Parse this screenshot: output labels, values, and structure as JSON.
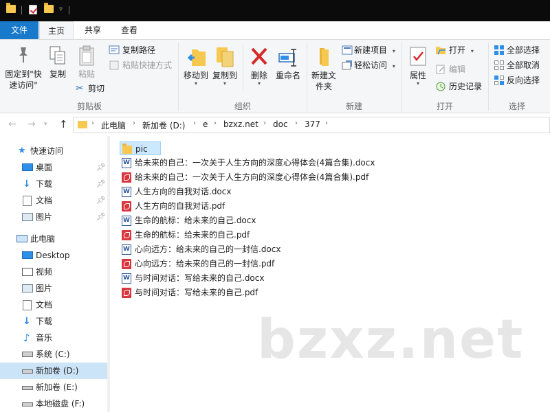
{
  "tabs": {
    "file": "文件",
    "home": "主页",
    "share": "共享",
    "view": "查看"
  },
  "ribbon": {
    "clipboard": {
      "pin_label": "固定到\"快速访问\"",
      "copy": "复制",
      "paste": "粘贴",
      "copy_path": "复制路径",
      "paste_shortcut": "粘贴快捷方式",
      "cut": "剪切",
      "group": "剪贴板"
    },
    "organize": {
      "move_to": "移动到",
      "copy_to": "复制到",
      "delete": "删除",
      "rename": "重命名",
      "group": "组织"
    },
    "new": {
      "new_folder": "新建文件夹",
      "new_item": "新建项目",
      "easy_access": "轻松访问",
      "group": "新建"
    },
    "open": {
      "properties": "属性",
      "open": "打开",
      "edit": "编辑",
      "history": "历史记录",
      "group": "打开"
    },
    "select": {
      "select_all": "全部选择",
      "select_none": "全部取消",
      "invert": "反向选择",
      "group": "选择"
    }
  },
  "address": {
    "crumbs": [
      "此电脑",
      "新加卷 (D:)",
      "e",
      "bzxz.net",
      "doc",
      "377"
    ]
  },
  "sidebar": {
    "quick_access": "快速访问",
    "quick_items": [
      "桌面",
      "下载",
      "文档",
      "图片"
    ],
    "this_pc": "此电脑",
    "pc_items": [
      "Desktop",
      "视频",
      "图片",
      "文档",
      "下载",
      "音乐",
      "系统 (C:)",
      "新加卷 (D:)",
      "新加卷 (E:)",
      "本地磁盘 (F:)"
    ]
  },
  "files": [
    {
      "name": "pic",
      "type": "folder"
    },
    {
      "name": "给未来的自己：一次关于人生方向的深度心得体会(4篇合集).docx",
      "type": "docx"
    },
    {
      "name": "给未来的自己：一次关于人生方向的深度心得体会(4篇合集).pdf",
      "type": "pdf"
    },
    {
      "name": "人生方向的自我对话.docx",
      "type": "docx"
    },
    {
      "name": "人生方向的自我对话.pdf",
      "type": "pdf"
    },
    {
      "name": "生命的航标：给未来的自己.docx",
      "type": "docx"
    },
    {
      "name": "生命的航标：给未来的自己.pdf",
      "type": "pdf"
    },
    {
      "name": "心向远方：给未来的自己的一封信.docx",
      "type": "docx"
    },
    {
      "name": "心向远方：给未来的自己的一封信.pdf",
      "type": "pdf"
    },
    {
      "name": "与时间对话：写给未来的自己.docx",
      "type": "docx"
    },
    {
      "name": "与时间对话：写给未来的自己.pdf",
      "type": "pdf"
    }
  ],
  "watermark": "bzxz.net",
  "colors": {
    "accent": "#1979ca",
    "selection": "#cce8ff",
    "folder": "#f6c850",
    "pdf": "#d9363e",
    "docx": "#2b5797"
  }
}
